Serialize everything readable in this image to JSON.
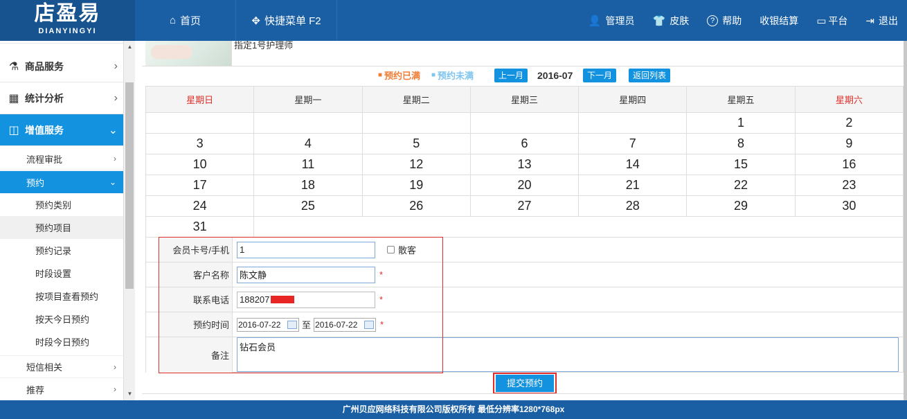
{
  "logo": {
    "main": "店盈易",
    "sub": "DIANYINGYI"
  },
  "topnav": {
    "left": [
      {
        "icon": "⌂",
        "label": "首页"
      },
      {
        "icon": "✥",
        "label": "快捷菜单 F2"
      }
    ],
    "right": [
      {
        "icon": "👤",
        "label": "管理员"
      },
      {
        "icon": "👕",
        "label": "皮肤"
      },
      {
        "icon": "?",
        "label": "帮助"
      },
      {
        "icon": "",
        "label": "收银结算"
      },
      {
        "icon": "▭",
        "label": "平台"
      },
      {
        "icon": "⇥",
        "label": "退出"
      }
    ]
  },
  "sidebar": {
    "main": [
      {
        "icon": "⚗",
        "label": "商品服务"
      },
      {
        "icon": "▦",
        "label": "统计分析"
      },
      {
        "icon": "◫",
        "label": "增值服务"
      }
    ],
    "subs": [
      {
        "label": "流程审批"
      },
      {
        "label": "预约"
      }
    ],
    "leaves": [
      "预约类别",
      "预约项目",
      "预约记录",
      "时段设置",
      "按项目查看预约",
      "按天今日预约",
      "时段今日预约"
    ],
    "bottom": [
      {
        "label": "短信相关"
      },
      {
        "label": "推荐"
      }
    ]
  },
  "content": {
    "assign_text": "指定1号护理师",
    "legend_full": "预约已满",
    "legend_free": "预约未满",
    "prev_month": "上一月",
    "month": "2016-07",
    "next_month": "下一月",
    "back_list": "返回列表",
    "weekdays": [
      "星期日",
      "星期一",
      "星期二",
      "星期三",
      "星期四",
      "星期五",
      "星期六"
    ],
    "weeks": [
      [
        "",
        "",
        "",
        "",
        "",
        "1",
        "2"
      ],
      [
        "3",
        "4",
        "5",
        "6",
        "7",
        "8",
        "9"
      ],
      [
        "10",
        "11",
        "12",
        "13",
        "14",
        "15",
        "16"
      ],
      [
        "17",
        "18",
        "19",
        "20",
        "21",
        "22",
        "23"
      ],
      [
        "24",
        "25",
        "26",
        "27",
        "28",
        "29",
        "30"
      ],
      [
        "31"
      ]
    ],
    "form": {
      "card_label": "会员卡号/手机",
      "card_value": "1",
      "walkin_label": "散客",
      "name_label": "客户名称",
      "name_value": "陈文静",
      "phone_label": "联系电话",
      "phone_value": "188207",
      "time_label": "预约时间",
      "date_from": "2016-07-22",
      "to_label": "至",
      "date_to": "2016-07-22",
      "note_label": "备注",
      "note_value": "钻石会员",
      "required_mark": "*"
    },
    "submit": "提交预约"
  },
  "footer": "广州贝应网络科技有限公司版权所有 最低分辨率1280*768px",
  "colors": {
    "topbar": "#1a5fa3",
    "accent": "#1392e0",
    "red": "#e0302a"
  }
}
